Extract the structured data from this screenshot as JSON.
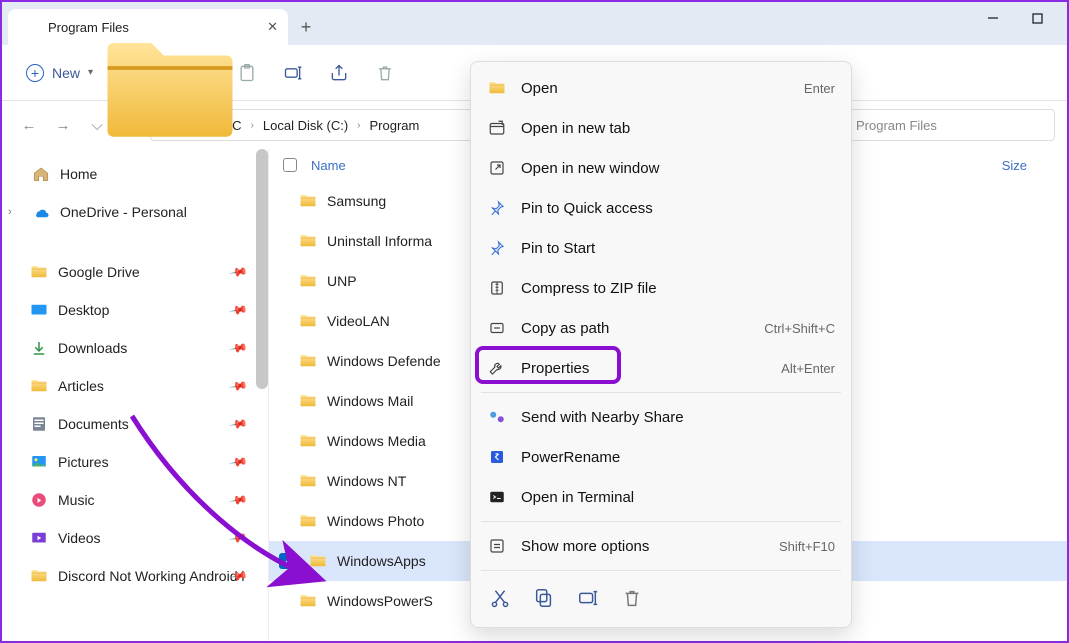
{
  "title": "Program Files",
  "toolbar": {
    "new_label": "New"
  },
  "breadcrumb": [
    "This PC",
    "Local Disk (C:)",
    "Program"
  ],
  "search": {
    "placeholder": "Program Files"
  },
  "sidebar": {
    "home": "Home",
    "onedrive": "OneDrive - Personal",
    "items": [
      "Google Drive",
      "Desktop",
      "Downloads",
      "Articles",
      "Documents",
      "Pictures",
      "Music",
      "Videos",
      "Discord Not Working Android i"
    ]
  },
  "columns": {
    "name": "Name",
    "size": "Size"
  },
  "files": [
    "Samsung",
    "Uninstall Informa",
    "UNP",
    "VideoLAN",
    "Windows Defende",
    "Windows Mail",
    "Windows Media",
    "Windows NT",
    "Windows Photo",
    "WindowsApps",
    "WindowsPowerS"
  ],
  "selected_index": 9,
  "context_menu": {
    "items": [
      {
        "label": "Open",
        "shortcut": "Enter",
        "icon": "open"
      },
      {
        "label": "Open in new tab",
        "icon": "newtab"
      },
      {
        "label": "Open in new window",
        "icon": "newwin"
      },
      {
        "label": "Pin to Quick access",
        "icon": "pin"
      },
      {
        "label": "Pin to Start",
        "icon": "pin"
      },
      {
        "label": "Compress to ZIP file",
        "icon": "zip"
      },
      {
        "label": "Copy as path",
        "shortcut": "Ctrl+Shift+C",
        "icon": "copypath"
      },
      {
        "label": "Properties",
        "shortcut": "Alt+Enter",
        "icon": "wrench",
        "highlight": true
      }
    ],
    "more": [
      {
        "label": "Send with Nearby Share",
        "icon": "share"
      },
      {
        "label": "PowerRename",
        "icon": "rename"
      },
      {
        "label": "Open in Terminal",
        "icon": "terminal"
      }
    ],
    "show_more": {
      "label": "Show more options",
      "shortcut": "Shift+F10"
    }
  }
}
